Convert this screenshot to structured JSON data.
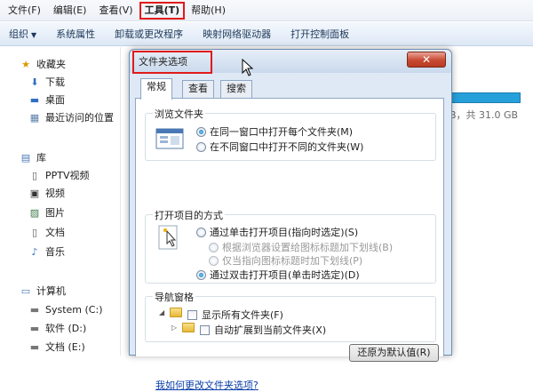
{
  "menubar": {
    "items": [
      {
        "label": "文件(F)"
      },
      {
        "label": "编辑(E)"
      },
      {
        "label": "查看(V)"
      },
      {
        "label": "工具(T)",
        "highlighted": true
      },
      {
        "label": "帮助(H)"
      }
    ]
  },
  "toolbar": {
    "items": [
      {
        "label": "组织",
        "dropdown": "▼"
      },
      {
        "label": "系统属性"
      },
      {
        "label": "卸载或更改程序"
      },
      {
        "label": "映射网络驱动器"
      },
      {
        "label": "打开控制面板"
      }
    ]
  },
  "sidebar": {
    "favorites": {
      "label": "收藏夹",
      "items": [
        {
          "label": "下载"
        },
        {
          "label": "桌面"
        },
        {
          "label": "最近访问的位置"
        }
      ]
    },
    "libraries": {
      "label": "库",
      "items": [
        {
          "label": "PPTV视频"
        },
        {
          "label": "视频"
        },
        {
          "label": "图片"
        },
        {
          "label": "文档"
        },
        {
          "label": "音乐"
        }
      ]
    },
    "computer": {
      "label": "计算机",
      "items": [
        {
          "label": "System (C:)"
        },
        {
          "label": "软件 (D:)"
        },
        {
          "label": "文档 (E:)"
        }
      ]
    }
  },
  "content": {
    "drive_info": "B，共 31.0 GB"
  },
  "dialog": {
    "title": "文件夹选项",
    "close_label": "✕",
    "tabs": [
      {
        "label": "常规",
        "selected": true
      },
      {
        "label": "查看"
      },
      {
        "label": "搜索"
      }
    ],
    "browse": {
      "legend": "浏览文件夹",
      "options": [
        {
          "label": "在同一窗口中打开每个文件夹(M)",
          "checked": true
        },
        {
          "label": "在不同窗口中打开不同的文件夹(W)",
          "checked": false
        }
      ]
    },
    "click": {
      "legend": "打开项目的方式",
      "options": [
        {
          "label": "通过单击打开项目(指向时选定)(S)",
          "checked": false,
          "disabled": false
        },
        {
          "label": "根据浏览器设置给图标标题加下划线(B)",
          "checked": false,
          "disabled": true
        },
        {
          "label": "仅当指向图标标题时加下划线(P)",
          "checked": true,
          "disabled": true
        },
        {
          "label": "通过双击打开项目(单击时选定)(D)",
          "checked": true,
          "disabled": false
        }
      ]
    },
    "nav": {
      "legend": "导航窗格",
      "options": [
        {
          "label": "显示所有文件夹(F)",
          "checked": false
        },
        {
          "label": "自动扩展到当前文件夹(X)",
          "checked": false
        }
      ]
    },
    "restore_label": "还原为默认值(R)",
    "help_link": "我如何更改文件夹选项?"
  },
  "colors": {
    "highlight": "#e01a1a",
    "link": "#0a3ea8",
    "accent": "#26a0da"
  }
}
